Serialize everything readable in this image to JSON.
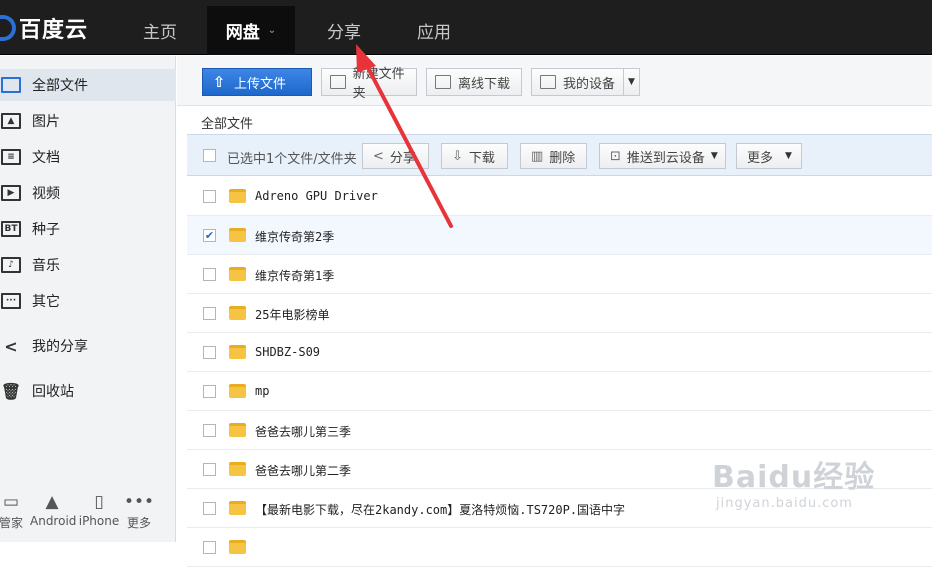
{
  "app": {
    "logo_text": "百度云"
  },
  "nav": {
    "items": [
      {
        "label": "主页"
      },
      {
        "label": "网盘",
        "caret": "⌄"
      },
      {
        "label": "分享"
      },
      {
        "label": "应用"
      }
    ],
    "active": "网盘"
  },
  "sidebar": {
    "items": [
      {
        "label": "全部文件",
        "icon": "cloud-icon"
      },
      {
        "label": "图片",
        "icon": "image-icon"
      },
      {
        "label": "文档",
        "icon": "document-icon"
      },
      {
        "label": "视频",
        "icon": "video-icon"
      },
      {
        "label": "种子",
        "icon": "bt-icon",
        "icon_text": "BT"
      },
      {
        "label": "音乐",
        "icon": "music-icon",
        "icon_text": "♪"
      },
      {
        "label": "其它",
        "icon": "other-icon",
        "icon_text": "···"
      },
      {
        "label": "我的分享",
        "icon": "share-icon",
        "icon_text": "<"
      },
      {
        "label": "回收站",
        "icon": "trash-icon",
        "icon_text": "🗑"
      }
    ],
    "devices": [
      {
        "label": "管家",
        "icon": "monitor-icon",
        "glyph": "▭"
      },
      {
        "label": "Android",
        "icon": "android-icon",
        "glyph": "🤖"
      },
      {
        "label": "iPhone",
        "icon": "iphone-icon",
        "glyph": "▯"
      },
      {
        "label": "更多",
        "icon": "more-icon",
        "glyph": "•••"
      }
    ]
  },
  "toolbar": {
    "upload_label": "上传文件",
    "new_folder_label": "新建文件夹",
    "offline_label": "离线下载",
    "devices_label": "我的设备"
  },
  "breadcrumb": "全部文件",
  "selection_bar": {
    "label": "已选中1个文件/文件夹",
    "share_label": "分享",
    "download_label": "下载",
    "delete_label": "删除",
    "push_label": "推送到云设备",
    "more_label": "更多"
  },
  "files": [
    {
      "name": "Adreno GPU Driver",
      "checked": false
    },
    {
      "name": "维京传奇第2季",
      "checked": true
    },
    {
      "name": "维京传奇第1季",
      "checked": false
    },
    {
      "name": "25年电影榜单",
      "checked": false
    },
    {
      "name": "SHDBZ-S09",
      "checked": false
    },
    {
      "name": "mp",
      "checked": false
    },
    {
      "name": "爸爸去哪儿第三季",
      "checked": false
    },
    {
      "name": "爸爸去哪儿第二季",
      "checked": false
    },
    {
      "name": "【最新电影下载，尽在2kandy.com】夏洛特烦恼.TS720P.国语中字",
      "checked": false
    },
    {
      "name": "",
      "checked": false
    }
  ],
  "watermark": {
    "main": "Baidu经验",
    "sub": "jingyan.baidu.com"
  },
  "colors": {
    "accent": "#1f68cc",
    "annotation_arrow": "#e8333a",
    "topbar": "#1e1e1e"
  }
}
